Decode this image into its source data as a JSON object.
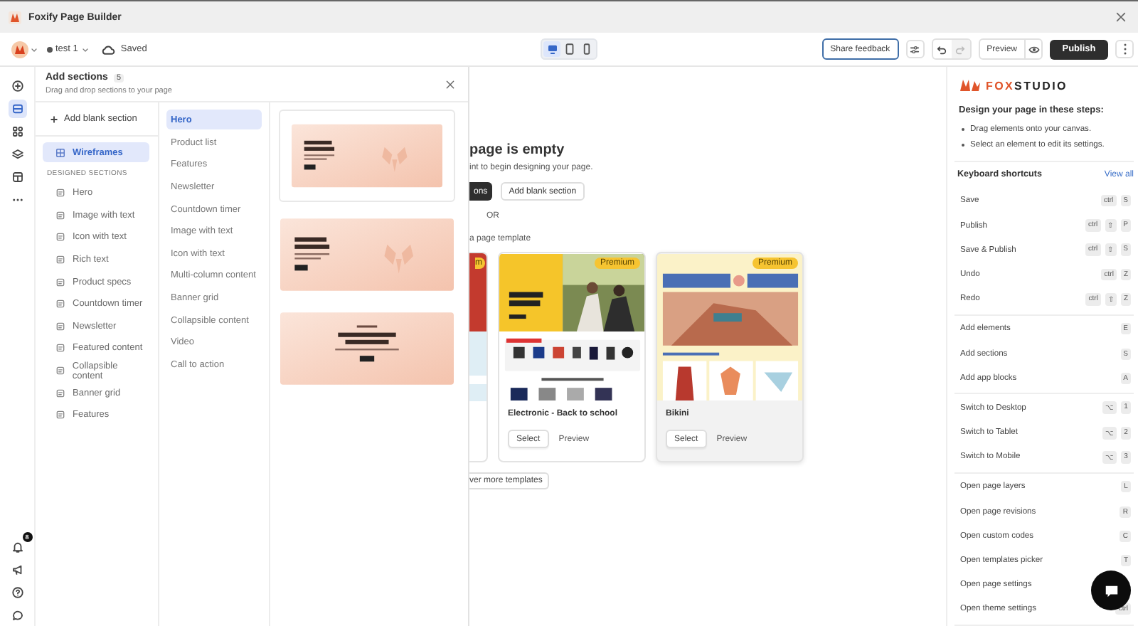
{
  "window": {
    "title": "Foxify Page Builder"
  },
  "toolbar": {
    "page_name": "test 1",
    "save_status": "Saved",
    "devices": [
      {
        "kind": "desktop",
        "selected": true
      },
      {
        "kind": "tablet",
        "selected": false
      },
      {
        "kind": "mobile",
        "selected": false
      }
    ],
    "share_feedback": "Share feedback",
    "undo": {
      "disabled": false
    },
    "redo": {
      "disabled": true
    },
    "preview": "Preview",
    "publish": "Publish"
  },
  "rail": {
    "items": [
      {
        "kind": "add",
        "selected": false
      },
      {
        "kind": "sections",
        "selected": true
      },
      {
        "kind": "apps",
        "selected": false
      },
      {
        "kind": "layers",
        "selected": false
      },
      {
        "kind": "theme",
        "selected": false
      },
      {
        "kind": "more",
        "selected": false
      }
    ],
    "bottom": [
      {
        "kind": "notifications",
        "badge": "8"
      },
      {
        "kind": "announcements"
      },
      {
        "kind": "help"
      },
      {
        "kind": "chat"
      }
    ]
  },
  "add_sections": {
    "title": "Add sections",
    "count": "5",
    "subtitle": "Drag and drop sections to your page",
    "add_blank": "Add blank section",
    "groups": [
      {
        "label": "Wireframes",
        "selected": true
      }
    ],
    "designed_heading": "DESIGNED SECTIONS",
    "designed": [
      {
        "label": "Hero",
        "selected": false
      },
      {
        "label": "Image with text",
        "selected": false
      },
      {
        "label": "Icon with text",
        "selected": false
      },
      {
        "label": "Rich text",
        "selected": false
      },
      {
        "label": "Product specs",
        "selected": false
      },
      {
        "label": "Countdown timer",
        "selected": false
      },
      {
        "label": "Newsletter",
        "selected": false
      },
      {
        "label": "Featured content",
        "selected": false
      },
      {
        "label": "Collapsible content",
        "selected": false
      },
      {
        "label": "Banner grid",
        "selected": false
      },
      {
        "label": "Features",
        "selected": false
      }
    ],
    "categories": [
      {
        "label": "Hero",
        "selected": true
      },
      {
        "label": "Product list",
        "selected": false
      },
      {
        "label": "Features",
        "selected": false
      },
      {
        "label": "Newsletter",
        "selected": false
      },
      {
        "label": "Countdown timer",
        "selected": false
      },
      {
        "label": "Image with text",
        "selected": false
      },
      {
        "label": "Icon with text",
        "selected": false
      },
      {
        "label": "Multi-column content",
        "selected": false
      },
      {
        "label": "Banner grid",
        "selected": false
      },
      {
        "label": "Collapsible content",
        "selected": false
      },
      {
        "label": "Video",
        "selected": false
      },
      {
        "label": "Call to action",
        "selected": false
      }
    ],
    "previews": [
      {
        "kind": "split",
        "framed": true
      },
      {
        "kind": "split",
        "framed": false
      },
      {
        "kind": "centered",
        "framed": false
      }
    ]
  },
  "canvas": {
    "heading": "page is empty",
    "hint": "int to begin designing your page.",
    "primary_button": "ons",
    "secondary_button": "Add blank section",
    "divider_text": "OR",
    "templates_heading": "a page template",
    "templates": [
      {
        "kind": "partial",
        "badge": "m",
        "hovered": false
      },
      {
        "kind": "full",
        "badge": "Premium",
        "name": "Electronic - Back to school",
        "select": "Select",
        "preview": "Preview",
        "hovered": false
      },
      {
        "kind": "full",
        "badge": "Premium",
        "name": "Bikini",
        "select": "Select",
        "preview": "Preview",
        "hovered": true
      }
    ],
    "more_button": "ver more templates"
  },
  "help_panel": {
    "brand_accent": "FOX",
    "brand_rest": "STUDIO",
    "steps_heading": "Design your page in these steps:",
    "steps": [
      "Drag elements onto your canvas.",
      "Select an element to edit its settings."
    ],
    "shortcuts_heading": "Keyboard shortcuts",
    "view_all": "View all",
    "groups": [
      [
        {
          "label": "Save",
          "keys": [
            "ctrl",
            "S"
          ]
        },
        {
          "label": "Publish",
          "keys": [
            "ctrl",
            "⇧",
            "P"
          ]
        },
        {
          "label": "Save & Publish",
          "keys": [
            "ctrl",
            "⇧",
            "S"
          ]
        },
        {
          "label": "Undo",
          "keys": [
            "ctrl",
            "Z"
          ]
        },
        {
          "label": "Redo",
          "keys": [
            "ctrl",
            "⇧",
            "Z"
          ]
        }
      ],
      [
        {
          "label": "Add elements",
          "keys": [
            "E"
          ]
        },
        {
          "label": "Add sections",
          "keys": [
            "S"
          ]
        },
        {
          "label": "Add app blocks",
          "keys": [
            "A"
          ]
        }
      ],
      [
        {
          "label": "Switch to Desktop",
          "keys": [
            "⌥",
            "1"
          ]
        },
        {
          "label": "Switch to Tablet",
          "keys": [
            "⌥",
            "2"
          ]
        },
        {
          "label": "Switch to Mobile",
          "keys": [
            "⌥",
            "3"
          ]
        }
      ],
      [
        {
          "label": "Open page layers",
          "keys": [
            "L"
          ]
        },
        {
          "label": "Open page revisions",
          "keys": [
            "R"
          ]
        },
        {
          "label": "Open custom codes",
          "keys": [
            "C"
          ]
        },
        {
          "label": "Open templates picker",
          "keys": [
            "T"
          ]
        },
        {
          "label": "Open page settings"
        },
        {
          "label": "Open theme settings",
          "keys": [
            "ctrl"
          ]
        }
      ]
    ]
  }
}
